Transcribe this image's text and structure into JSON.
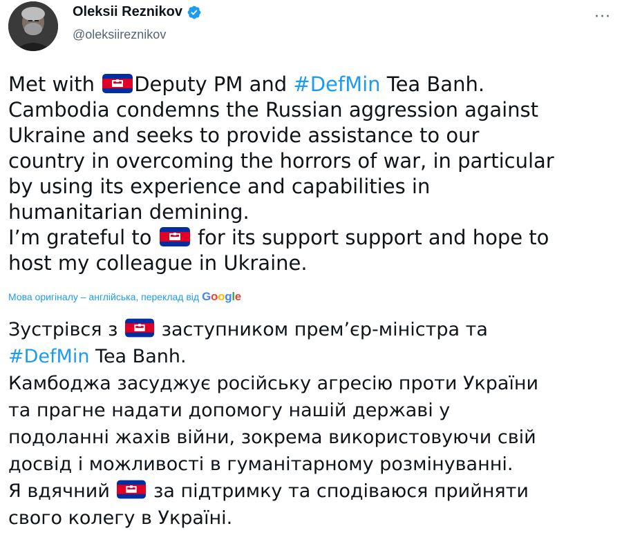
{
  "author": {
    "display_name": "Oleksii Reznikov",
    "handle": "@oleksiireznikov",
    "avatar_icon": "avatar-photo",
    "verified_icon": "verified-badge-icon"
  },
  "menu": {
    "more_label": "···"
  },
  "tweet_en": {
    "l1_a": "Met with ",
    "l1_b": "Deputy PM and ",
    "l1_tag": "#DefMin",
    "l1_c": " Tea Banh.",
    "l2": "Cambodia condemns the Russian aggression against",
    "l3": "Ukraine and seeks to provide assistance to our",
    "l4": "country in overcoming the horrors of war, in particular",
    "l5": "by using its experience and capabilities in",
    "l6": "humanitarian demining.",
    "l7_a": "I’m grateful to ",
    "l7_b": " for its support support and hope to",
    "l8": "host my colleague in Ukraine."
  },
  "translation_note": {
    "text": "Мова оригіналу – англійська, переклад від",
    "google": [
      "G",
      "o",
      "o",
      "g",
      "l",
      "e"
    ]
  },
  "tweet_uk": {
    "l1_a": "Зустрівся з ",
    "l1_b": " заступником прем’єр-міністра та",
    "l2_tag": "#DefMin",
    "l2_b": " Tea Banh.",
    "l3": "Камбоджа засуджує російську агресію проти України",
    "l4": "та прагне надати допомогу нашій державі у",
    "l5": "подоланні жахів війни, зокрема використовуючи свій",
    "l6": "досвід і можливості в гуманітарному розмінуванні.",
    "l7_a": "Я вдячний ",
    "l7_b": " за підтримку та сподіваюся прийняти",
    "l8": "свого колегу в Україні."
  },
  "colors": {
    "text": "#0f1419",
    "secondary": "#536471",
    "link": "#1d9bf0",
    "verified": "#1d9bf0",
    "flag_blue": "#032ea1",
    "flag_red": "#e00025"
  },
  "flag_icon": "cambodia-flag-icon"
}
